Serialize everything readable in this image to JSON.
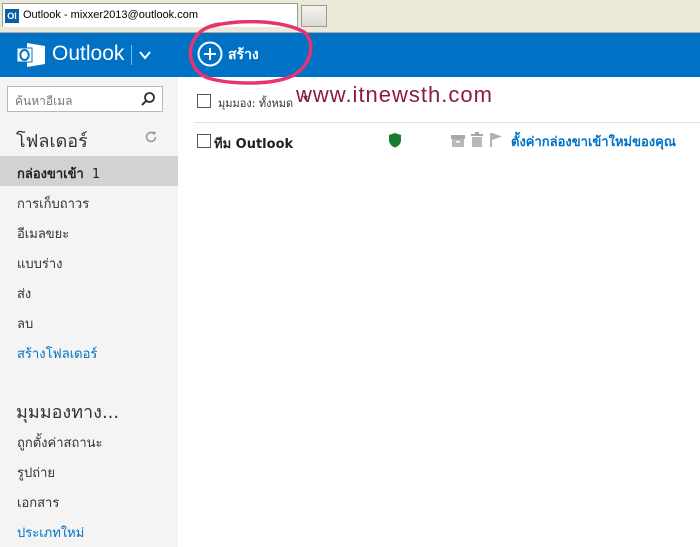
{
  "browser": {
    "tab_icon": "Ol",
    "tab_title": "Outlook - mixxer2013@outlook.com"
  },
  "header": {
    "app_name": "Outlook",
    "new_label": "สร้าง",
    "accent": "#0072c6"
  },
  "search": {
    "placeholder": "ค้นหาอีเมล"
  },
  "folders": {
    "heading": "โฟลเดอร์",
    "items": [
      {
        "label": "กล่องขาเข้า",
        "count": "1",
        "selected": true
      },
      {
        "label": "การเก็บถาวร"
      },
      {
        "label": "อีเมลขยะ"
      },
      {
        "label": "แบบร่าง"
      },
      {
        "label": "ส่ง"
      },
      {
        "label": "ลบ"
      },
      {
        "label": "สร้างโฟลเดอร์",
        "link": true
      }
    ]
  },
  "views": {
    "heading": "มุมมองทาง...",
    "items": [
      {
        "label": "ถูกตั้งค่าสถานะ"
      },
      {
        "label": "รูปถ่าย"
      },
      {
        "label": "เอกสาร"
      },
      {
        "label": "ประเภทใหม่",
        "link": true
      }
    ]
  },
  "list": {
    "view_label": "มุมมอง: ทั้งหมด",
    "view_caret": "▾",
    "messages": [
      {
        "sender": "ทีม Outlook",
        "subject": "ตั้งค่ากล่องขาเข้าใหม่ของคุณ"
      }
    ]
  },
  "annotation": {
    "watermark": "www.itnewsth.com",
    "color": "#8b1a4a"
  },
  "icons": [
    "outlook-logo-icon",
    "chevron-down-icon",
    "plus-circle-icon",
    "search-icon",
    "refresh-icon",
    "shield-icon",
    "archive-icon",
    "delete-icon",
    "flag-icon"
  ]
}
